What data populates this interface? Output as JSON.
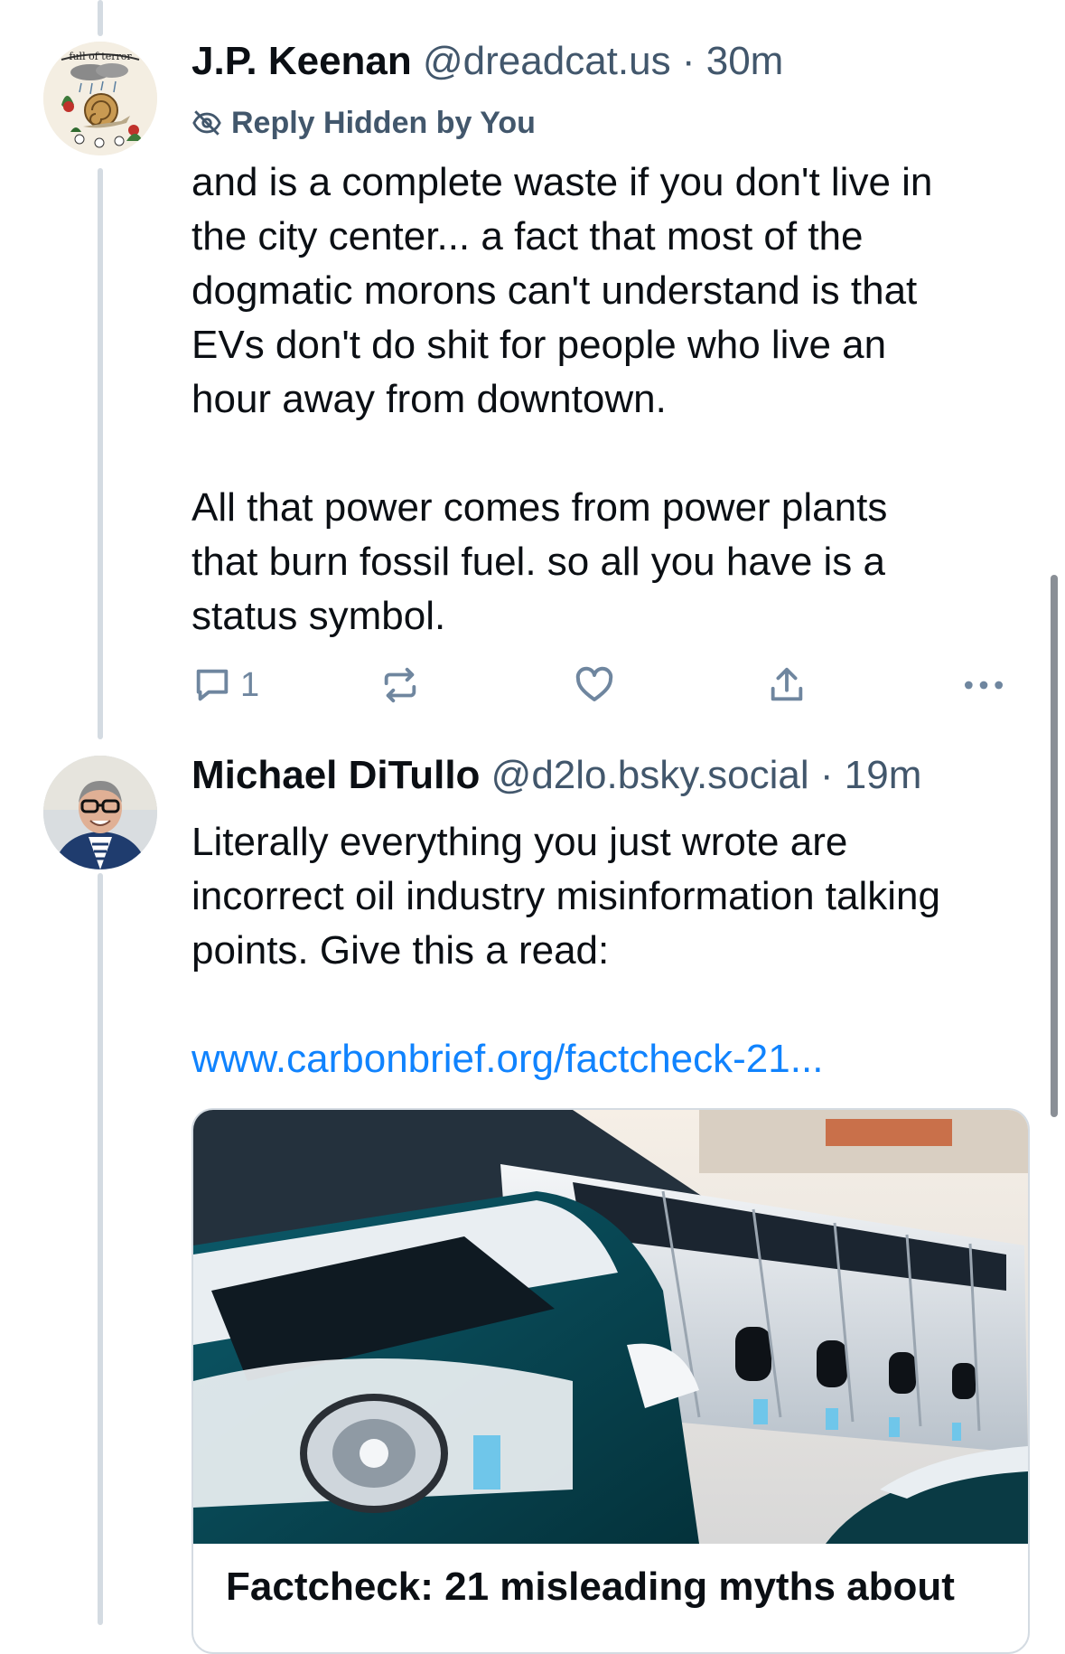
{
  "posts": [
    {
      "author": "J.P. Keenan",
      "handle": "@dreadcat.us",
      "separator": "·",
      "time": "30m",
      "hidden_label": "Reply Hidden by You",
      "avatar_text": "full of terror",
      "text": "and is a complete waste if you don't live in\nthe city center... a fact that most of the\ndogmatic morons can't understand is that\nEVs don't do shit for people who live an\nhour away from downtown.\n\nAll that power comes from power plants\nthat burn fossil fuel. so all you have is a\nstatus symbol.",
      "actions": {
        "reply_count": "1"
      }
    },
    {
      "author": "Michael DiTullo",
      "handle": "@d2lo.bsky.social",
      "separator": "·",
      "time": "19m",
      "text": "Literally everything you just wrote are\nincorrect oil industry misinformation talking\npoints. Give this a read:",
      "link": "www.carbonbrief.org/factcheck-21...",
      "card": {
        "title": "Factcheck: 21 misleading myths about"
      }
    }
  ],
  "icons": {
    "hidden": "eye-slash-icon",
    "reply": "speech-bubble-icon",
    "repost": "repost-arrows-icon",
    "like": "heart-icon",
    "share": "share-upload-icon",
    "more": "more-dots-icon"
  },
  "colors": {
    "text": "#0b0f14",
    "secondary": "#42576c",
    "icon": "#6f869f",
    "link": "#1083fe",
    "thread_line": "#d4dbe2"
  }
}
